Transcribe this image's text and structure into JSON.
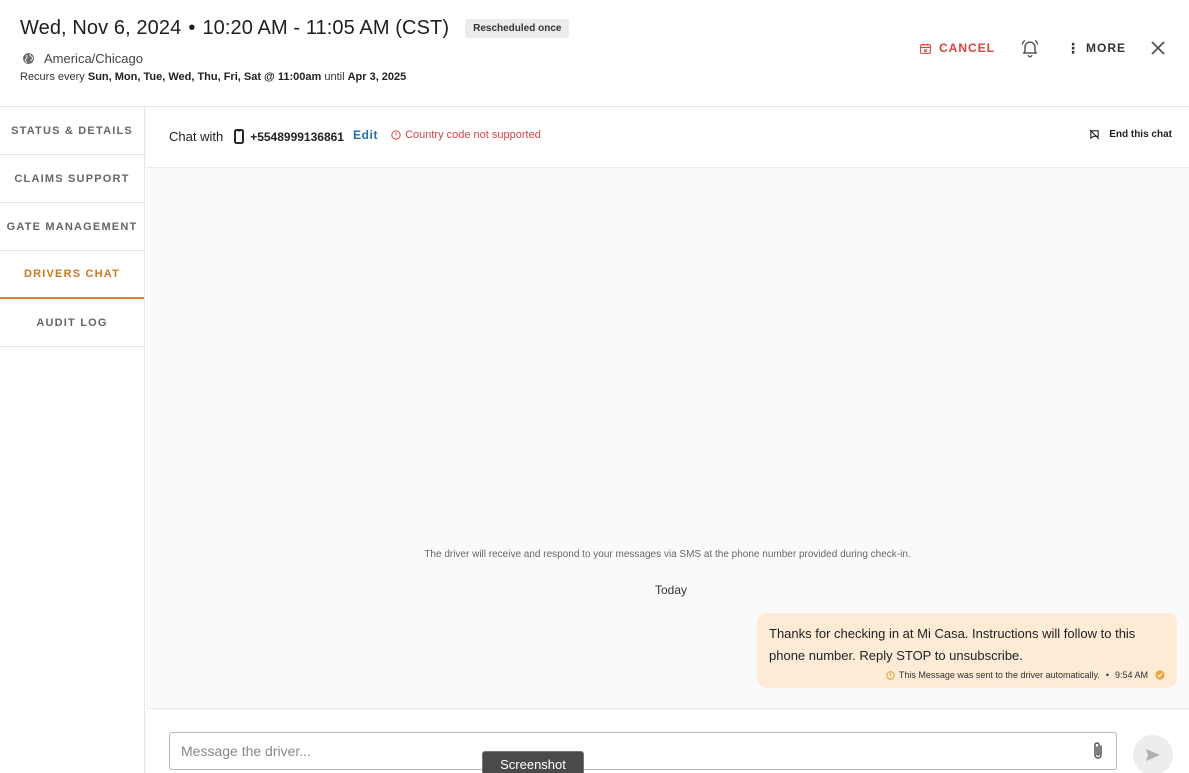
{
  "header": {
    "date": "Wed, Nov 6, 2024",
    "dot": "•",
    "time_range": "10:20 AM - 11:05 AM (CST)",
    "badge": "Rescheduled once",
    "timezone": "America/Chicago",
    "recur_prefix": "Recurs every",
    "recur_days": "Sun, Mon, Tue, Wed, Thu, Fri, Sat @ 11:00am",
    "recur_until_word": "until",
    "recur_until_date": "Apr 3, 2025"
  },
  "actions": {
    "cancel_label": "CANCEL",
    "more_label": "MORE"
  },
  "sidebar": {
    "items": [
      {
        "label": "STATUS & DETAILS"
      },
      {
        "label": "CLAIMS SUPPORT"
      },
      {
        "label": "GATE MANAGEMENT"
      },
      {
        "label": "DRIVERS CHAT",
        "active": true
      },
      {
        "label": "AUDIT LOG"
      }
    ]
  },
  "chat": {
    "with_label": "Chat with",
    "phone": "+5548999136861",
    "edit_label": "Edit",
    "warning": "Country code not supported",
    "end_label": "End this chat",
    "info": "The driver will receive and respond to your messages via SMS at the phone number provided during check-in.",
    "day_label": "Today",
    "messages": [
      {
        "text": "Thanks for checking in at Mi Casa. Instructions will follow to this phone number. Reply STOP to unsubscribe.",
        "note": "This Message was sent to the driver automatically.",
        "sep": "•",
        "time": "9:54 AM"
      }
    ],
    "composer_placeholder": "Message the driver..."
  },
  "overlay": {
    "screenshot_tab": "Screenshot"
  },
  "colors": {
    "accent": "#d88a2a",
    "danger": "#d9443a",
    "link": "#1c6fb3",
    "bubble": "#fdebd6"
  }
}
